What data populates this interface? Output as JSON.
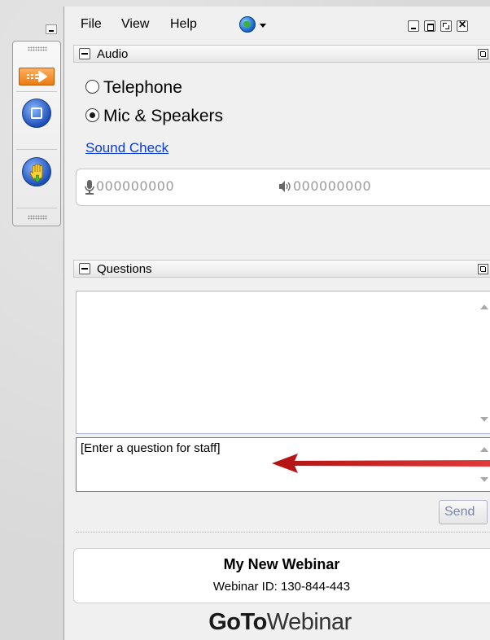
{
  "menu": {
    "items": [
      "File",
      "View",
      "Help"
    ],
    "language_icon": "globe-icon"
  },
  "audio": {
    "title": "Audio",
    "options": [
      {
        "label": "Telephone",
        "selected": false
      },
      {
        "label": "Mic & Speakers",
        "selected": true
      }
    ],
    "sound_check": "Sound Check",
    "mic_level": "000000000",
    "speaker_level": "000000000"
  },
  "questions": {
    "title": "Questions",
    "input_value": "[Enter a question for staff]",
    "send_label": "Send"
  },
  "webinar": {
    "title": "My New Webinar",
    "id_text": "Webinar ID: 130-844-443"
  },
  "brand": {
    "bold": "GoTo",
    "regular": "Webinar"
  },
  "colors": {
    "annotation_arrow": "#cc1f1f",
    "link": "#0a3cdc"
  }
}
